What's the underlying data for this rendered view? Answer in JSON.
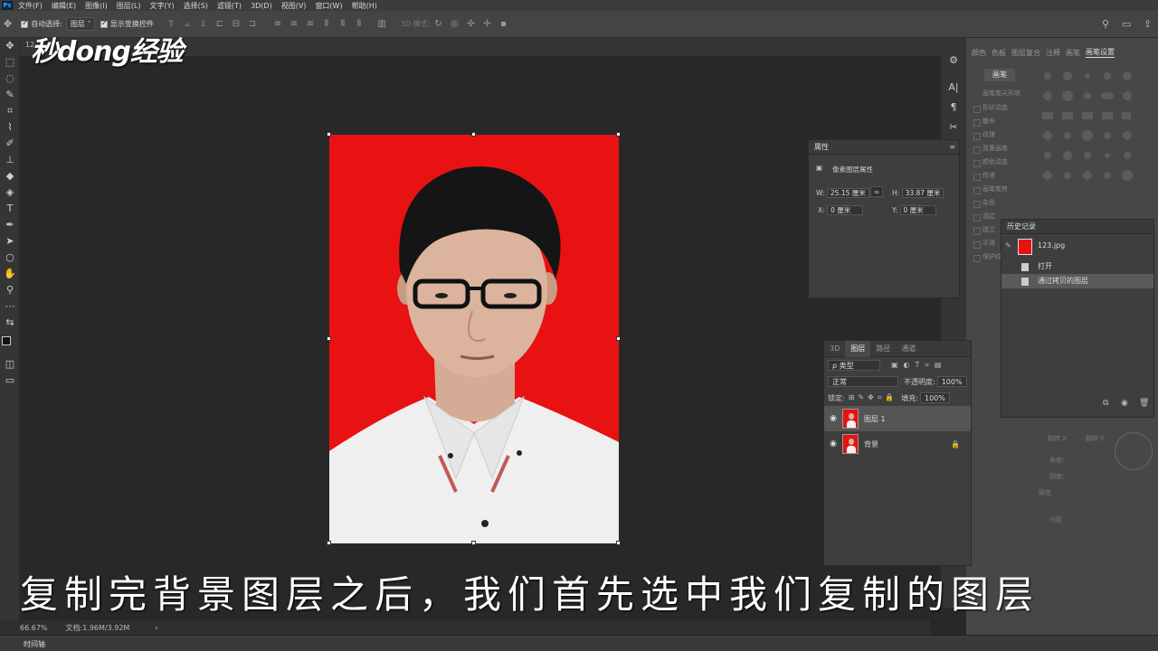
{
  "menu": {
    "logo": "Ps",
    "items": [
      "文件(F)",
      "编辑(E)",
      "图像(I)",
      "图层(L)",
      "文字(Y)",
      "选择(S)",
      "滤镜(T)",
      "3D(D)",
      "视图(V)",
      "窗口(W)",
      "帮助(H)"
    ]
  },
  "options": {
    "auto_select_label": "自动选择:",
    "auto_select_value": "图层",
    "show_transform_label": "显示变换控件",
    "mode_label": "3D 模式:"
  },
  "tabstrip": {
    "tab_label": "12"
  },
  "watermark": {
    "text": "秒dong经验"
  },
  "caption": {
    "text": "复制完背景图层之后，我们首先选中我们复制的图层"
  },
  "status": {
    "zoom": "66.67%",
    "doc_info": "文档:1.96M/3.92M",
    "arrow": "›"
  },
  "timeline": {
    "label": "时间轴"
  },
  "brush_panel": {
    "tabs": [
      "颜色",
      "色板",
      "图层复合",
      "注释",
      "画笔",
      "画笔设置"
    ],
    "active_tab": "画笔设置",
    "brushes_button": "画笔",
    "header": "画笔笔尖形状",
    "items": [
      "形状动态",
      "散布",
      "纹理",
      "双重画笔",
      "颜色动态",
      "传递",
      "画笔笔势",
      "杂色",
      "湿边",
      "建立",
      "平滑",
      "保护纹理"
    ]
  },
  "properties": {
    "title": "属性",
    "subtitle": "像素图层属性",
    "w_label": "W:",
    "w_value": "25.15 厘米",
    "h_label": "H:",
    "h_value": "33.87 厘米",
    "x_label": "X:",
    "x_value": "0 厘米",
    "y_label": "Y:",
    "y_value": "0 厘米",
    "link_icon": "∞"
  },
  "history": {
    "title": "历史记录",
    "snapshot_name": "123.jpg",
    "items": [
      {
        "label": "打开",
        "selected": false
      },
      {
        "label": "通过拷贝的图层",
        "selected": true
      }
    ]
  },
  "layers": {
    "tabs": [
      "3D",
      "图层",
      "路径",
      "通道"
    ],
    "active_tab": "图层",
    "filter_label": "ρ 类型",
    "blend_mode": "正常",
    "opacity_label": "不透明度:",
    "opacity_value": "100%",
    "lock_label": "锁定:",
    "fill_label": "填充:",
    "fill_value": "100%",
    "rows": [
      {
        "name": "图层 1",
        "selected": true,
        "locked": false
      },
      {
        "name": "背景",
        "selected": false,
        "locked": true
      }
    ]
  },
  "faded_transform": {
    "flip_x": "翻转 X",
    "flip_y": "翻转 Y",
    "angle": "角度:",
    "roundness": "圆度:",
    "hardness": "硬度",
    "spacing": "间距"
  },
  "colors": {
    "photo_bg": "#e81212",
    "panel": "#3e3e3e",
    "app_bg": "#282828"
  }
}
